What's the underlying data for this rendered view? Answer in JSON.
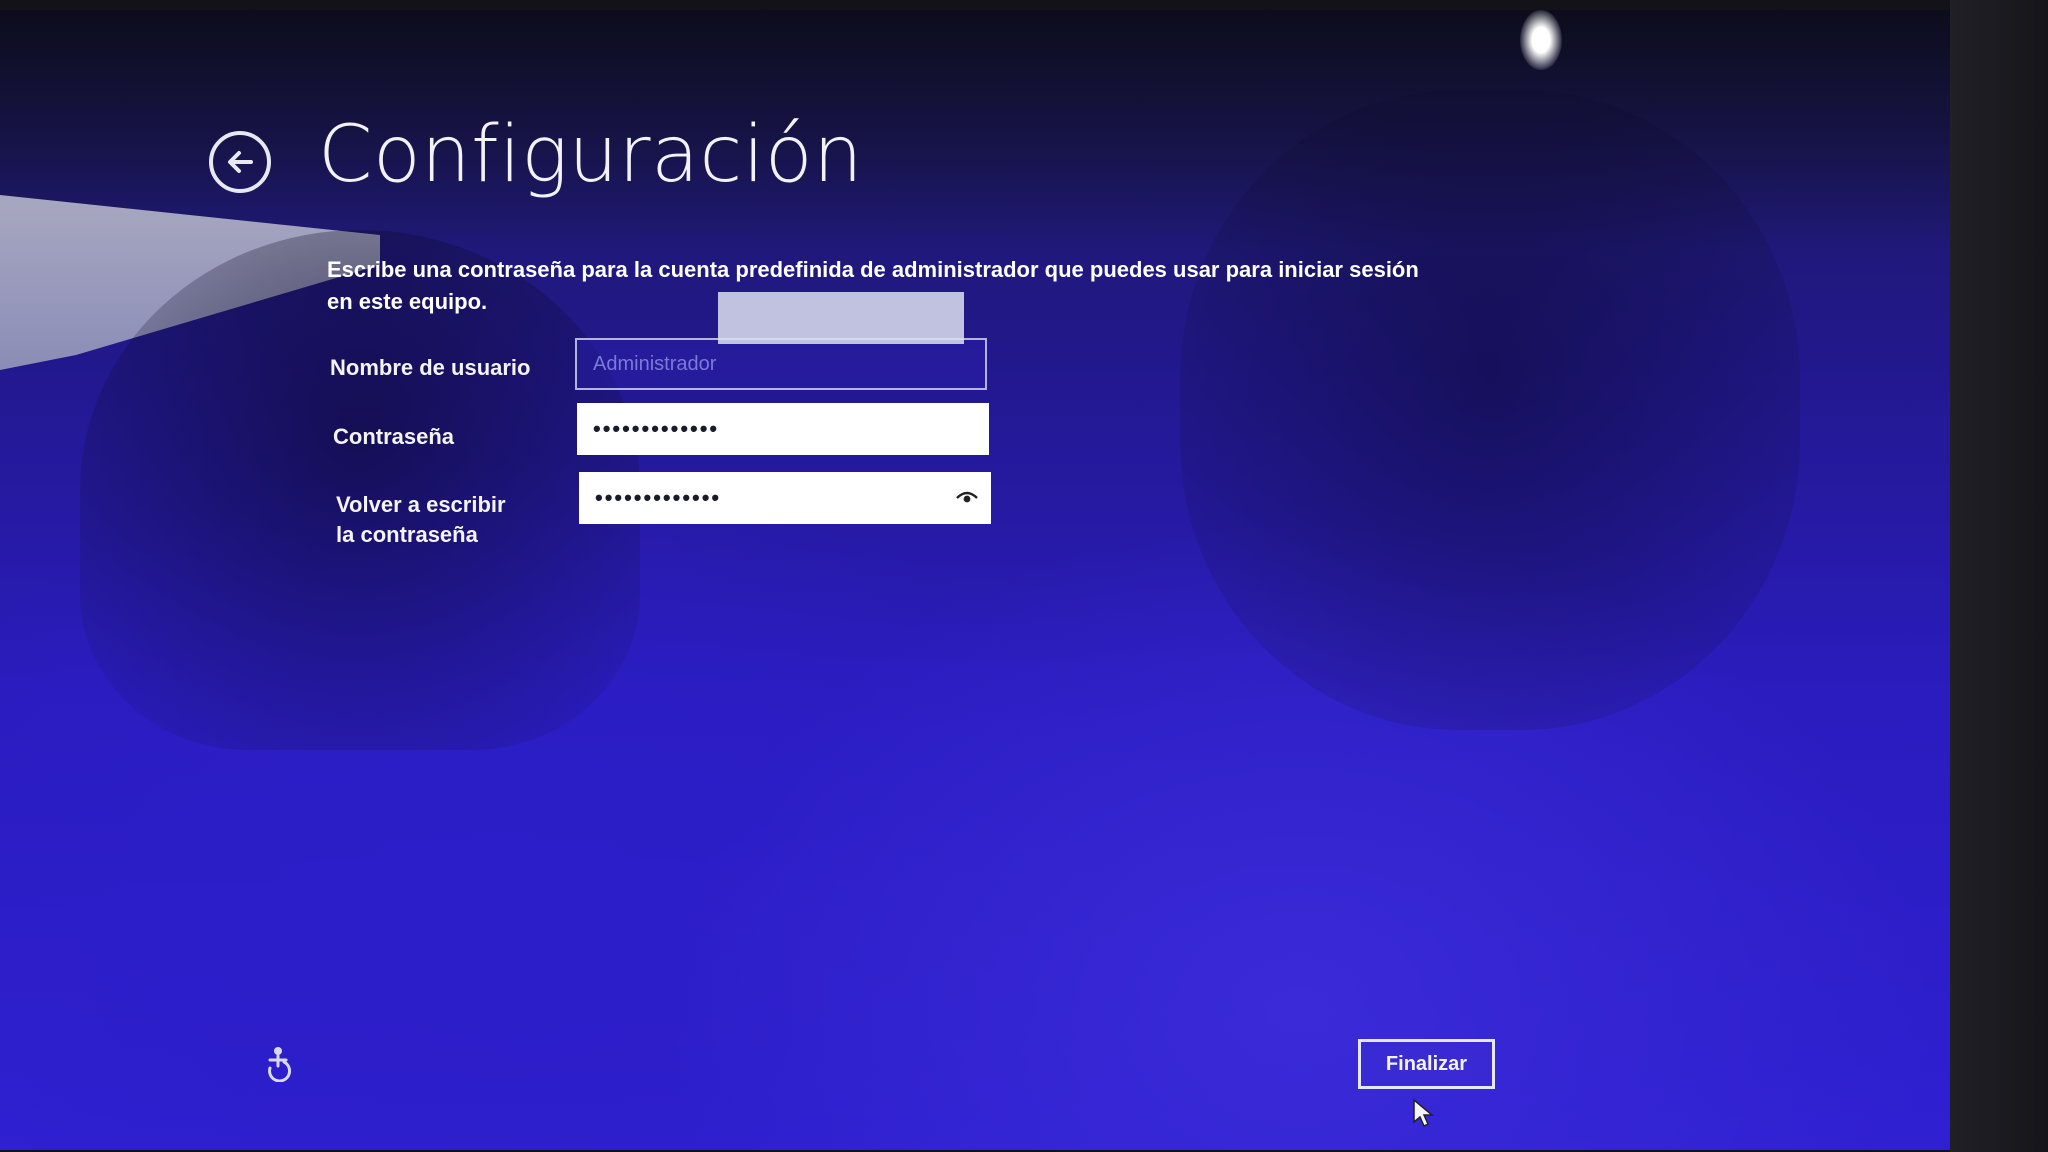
{
  "page": {
    "title": "Configuración",
    "description": "Escribe una contraseña para la cuenta predefinida de administrador que puedes usar para iniciar sesión en este equipo."
  },
  "form": {
    "username_label": "Nombre de usuario",
    "username_placeholder": "Administrador",
    "password_label": "Contraseña",
    "password_value": "•••••••••••••",
    "confirm_label": "Volver a escribir la contraseña",
    "confirm_value": "•••••••••••••"
  },
  "footer": {
    "finish_label": "Finalizar"
  },
  "icons": {
    "back": "back-arrow-icon",
    "reveal": "eye-icon",
    "accessibility": "ease-of-access-icon",
    "cursor": "mouse-pointer-icon"
  },
  "colors": {
    "background": "#2a1cbe",
    "text": "#ffffff",
    "field": "#ffffff",
    "field_border": "#b4b4e0"
  }
}
